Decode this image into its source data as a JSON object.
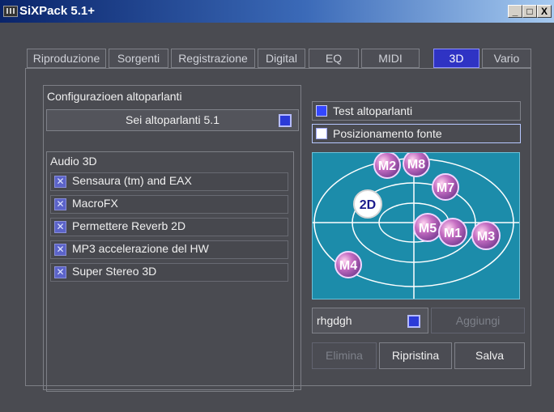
{
  "window": {
    "title": "SiXPack 5.1+",
    "controls": {
      "minimize": "_",
      "maximize": "□",
      "close": "X"
    }
  },
  "tabs": [
    {
      "label": "Riproduzione",
      "active": false
    },
    {
      "label": "Sorgenti",
      "active": false
    },
    {
      "label": "Registrazione",
      "active": false
    },
    {
      "label": "Digital",
      "active": false
    },
    {
      "label": "EQ",
      "active": false
    },
    {
      "label": "MIDI",
      "active": false
    },
    {
      "label": "3D",
      "active": true
    },
    {
      "label": "Vario",
      "active": false
    }
  ],
  "speaker_config": {
    "label": "Configurazioen altoparlanti",
    "selected": "Sei altoparlanti 5.1"
  },
  "audio3d": {
    "label": "Audio 3D",
    "options": [
      "Sensaura (tm) and EAX",
      "MacroFX",
      "Permettere Reverb 2D",
      "MP3 accelerazione del HW",
      "Super Stereo 3D"
    ]
  },
  "mode": {
    "test": "Test altoparlanti",
    "position": "Posizionamento fonte",
    "selected": "Posizionamento fonte"
  },
  "radar": {
    "markers": [
      "M2",
      "M8",
      "M7",
      "2D",
      "M5",
      "M1",
      "M3",
      "M4"
    ]
  },
  "preset": {
    "value": "rhgdgh"
  },
  "buttons": {
    "add": "Aggiungi",
    "delete": "Elimina",
    "reset": "Ripristina",
    "save": "Salva"
  }
}
